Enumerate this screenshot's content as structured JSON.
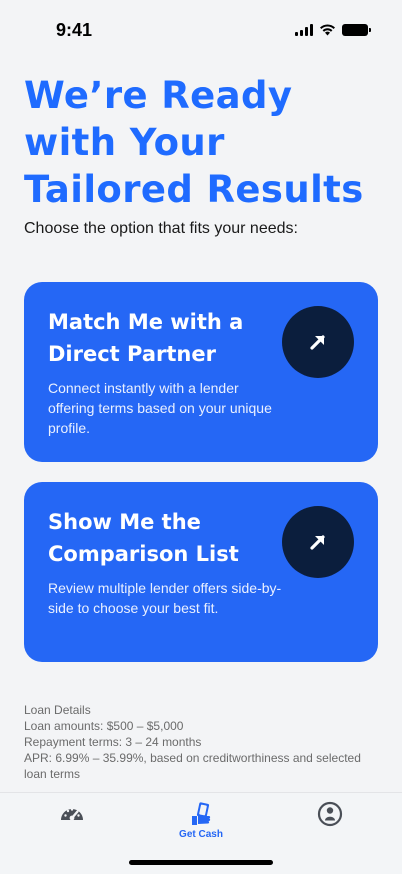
{
  "status_bar": {
    "time": "9:41"
  },
  "headline": "We’re Ready with Your Tailored Results",
  "subheading": "Choose the option that fits your needs:",
  "options": [
    {
      "title": "Match Me with a Direct Partner",
      "description": "Connect instantly with a lender offering terms based on your unique profile.",
      "icon": "arrow-up-right-icon"
    },
    {
      "title": "Show Me the Comparison List",
      "description": "Review multiple lender offers side-by-side to choose your best fit.",
      "icon": "arrow-up-right-icon"
    }
  ],
  "loan_details": {
    "heading": "Loan Details",
    "amounts": "Loan amounts: $500 – $5,000",
    "terms": "Repayment terms: 3 – 24 months",
    "apr": "APR: 6.99% – 35.99%, based on creditworthiness and selected loan terms"
  },
  "bottom_nav": {
    "items": [
      {
        "label": "",
        "icon": "speedometer-icon",
        "active": false
      },
      {
        "label": "Get Cash",
        "icon": "cash-hand-icon",
        "active": true
      },
      {
        "label": "",
        "icon": "profile-icon",
        "active": false
      }
    ]
  },
  "colors": {
    "accent": "#2567f5",
    "headline": "#1f6bff",
    "arrow_circle": "#0b1e3d",
    "background": "#f3f4f6"
  }
}
